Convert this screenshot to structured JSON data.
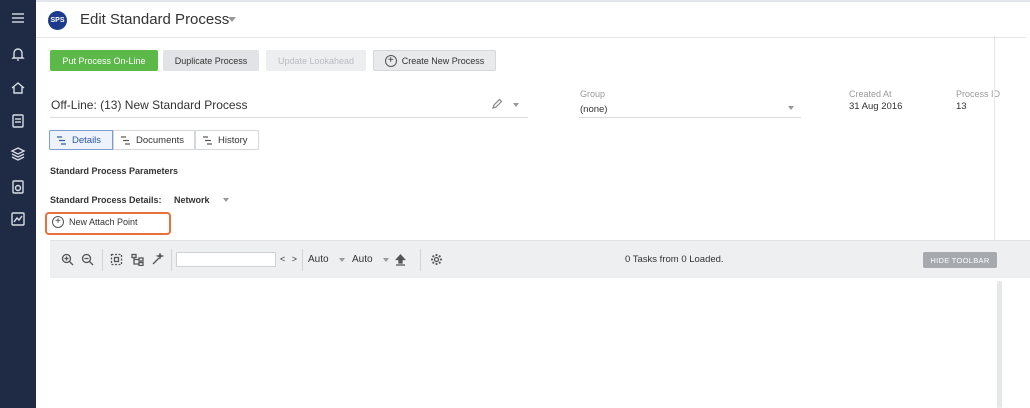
{
  "header": {
    "logo_text": "SPS",
    "title": "Edit Standard Process"
  },
  "actions": {
    "put_online": "Put Process On-Line",
    "duplicate": "Duplicate Process",
    "update_lookahead": "Update Lookahead",
    "create_new": "Create New Process"
  },
  "process": {
    "name": "Off-Line: (13) New Standard Process",
    "group_label": "Group",
    "group_value": "(none)",
    "created_label": "Created At",
    "created_value": "31 Aug 2016",
    "id_label": "Process ID",
    "id_value": "13"
  },
  "tabs": [
    {
      "label": "Details",
      "active": true
    },
    {
      "label": "Documents",
      "active": false
    },
    {
      "label": "History",
      "active": false
    }
  ],
  "parameters": {
    "section_title": "Standard Process Parameters",
    "details_label": "Standard Process Details:",
    "details_value": "Network",
    "new_attach_point": "New Attach Point"
  },
  "toolbar": {
    "nav": "< >",
    "select_1": "Auto",
    "select_2": "Auto",
    "status": "0 Tasks from 0 Loaded.",
    "hide_toolbar": "HIDE TOOLBAR"
  },
  "colors": {
    "sidebar": "#1f2a44",
    "primary_green": "#5cb848",
    "highlight_orange": "#e8703a",
    "active_tab": "#2a55a8"
  },
  "icons": {
    "sidebar": [
      "menu-icon",
      "bell-icon",
      "home-icon",
      "document-icon",
      "layers-icon",
      "report-icon",
      "chart-icon"
    ]
  }
}
